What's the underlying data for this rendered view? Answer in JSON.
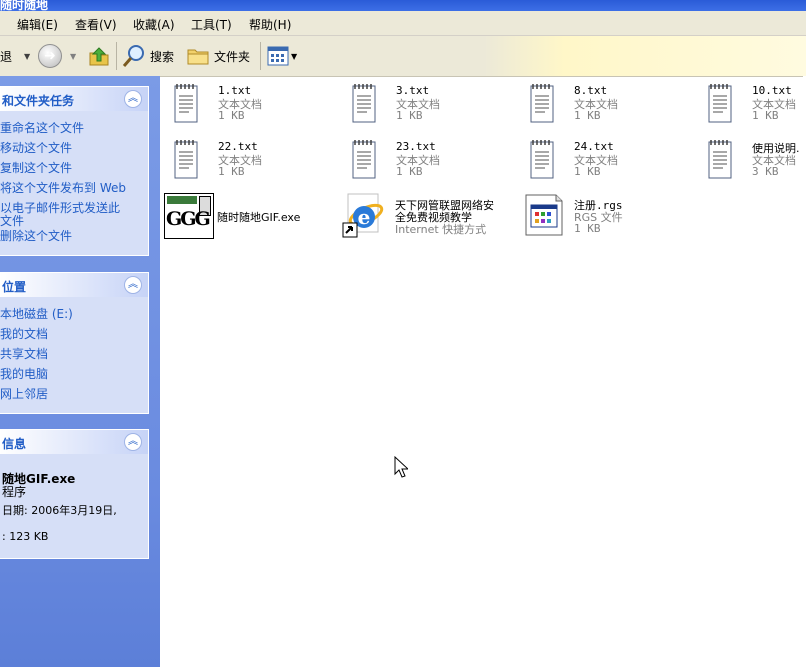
{
  "window": {
    "title": "随时随地"
  },
  "menu": [
    "编辑(E)",
    "查看(V)",
    "收藏(A)",
    "工具(T)",
    "帮助(H)"
  ],
  "toolbar": {
    "back_label": "退",
    "search_label": "搜索",
    "folders_label": "文件夹"
  },
  "tasks_panel": {
    "title": "和文件夹任务",
    "items": [
      "重命名这个文件",
      "移动这个文件",
      "复制这个文件",
      "将这个文件发布到 Web",
      "以电子邮件形式发送此",
      "文件",
      "删除这个文件"
    ]
  },
  "places_panel": {
    "title": "位置",
    "items": [
      "本地磁盘 (E:)",
      "我的文档",
      "共享文档",
      "我的电脑",
      "网上邻居"
    ]
  },
  "details_panel": {
    "title": "信息",
    "name": "随地GIF.exe",
    "type": "程序",
    "date": "日期: 2006年3月19日,",
    "size": ": 123 KB"
  },
  "files": [
    {
      "name": "1.txt",
      "type": "文本文档",
      "size": "1 KB"
    },
    {
      "name": "3.txt",
      "type": "文本文档",
      "size": "1 KB"
    },
    {
      "name": "8.txt",
      "type": "文本文档",
      "size": "1 KB"
    },
    {
      "name": "10.txt",
      "type": "文本文档",
      "size": "1 KB"
    },
    {
      "name": "22.txt",
      "type": "文本文档",
      "size": "1 KB"
    },
    {
      "name": "23.txt",
      "type": "文本文档",
      "size": "1 KB"
    },
    {
      "name": "24.txt",
      "type": "文本文档",
      "size": "1 KB"
    },
    {
      "name": "使用说明.",
      "type": "文本文档",
      "size": "3 KB"
    },
    {
      "name": "随时随地GIF.exe",
      "logo_text": "GGG"
    },
    {
      "name_line1": "天下网管联盟网络安",
      "name_line2": "全免费视频教学",
      "type": "Internet 快捷方式"
    },
    {
      "name": "注册.rgs",
      "type": "RGS 文件",
      "size": "1 KB"
    }
  ]
}
